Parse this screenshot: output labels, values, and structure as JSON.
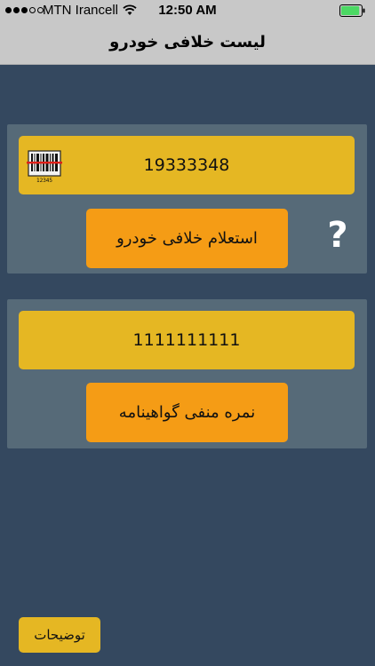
{
  "status_bar": {
    "carrier": "MTN Irancell",
    "time": "12:50 AM",
    "signal_bars_filled": 3,
    "signal_bars_total": 5,
    "wifi_icon": "wifi-icon",
    "battery_level": 0.92,
    "battery_color": "#4cd964"
  },
  "nav": {
    "title": "لیست خلافی خودرو"
  },
  "vehicle_fines": {
    "barcode_value": "19333348",
    "barcode_icon": "barcode-scanner-icon",
    "barcode_digits": "12345",
    "button_label": "استعلام خلافی خودرو",
    "help_label": "?"
  },
  "license_points": {
    "license_value": "1111111111",
    "button_label": "نمره منفی گواهینامه"
  },
  "footer": {
    "description_label": "توضیحات"
  },
  "colors": {
    "background": "#34485f",
    "panel": "#566a78",
    "field": "#e5b723",
    "button": "#f59c15",
    "bar": "#c8c8c8"
  }
}
